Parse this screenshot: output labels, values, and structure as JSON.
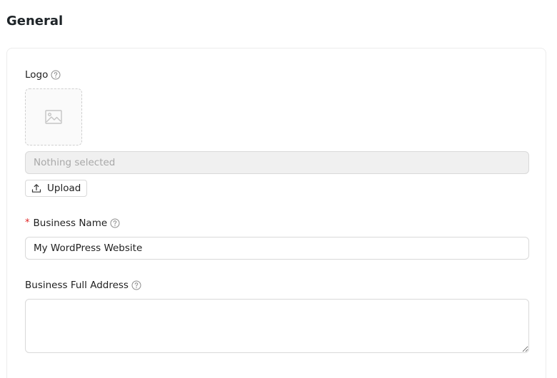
{
  "section": {
    "title": "General"
  },
  "logo": {
    "label": "Logo",
    "help_icon": "question-circle-icon",
    "placeholder_icon": "image-icon",
    "file_display": "Nothing selected",
    "upload_label": "Upload",
    "upload_icon": "upload-icon"
  },
  "business_name": {
    "required_mark": "*",
    "label": "Business Name",
    "help_icon": "question-circle-icon",
    "value": "My WordPress Website"
  },
  "business_address": {
    "label": "Business Full Address",
    "help_icon": "question-circle-icon",
    "value": ""
  },
  "colors": {
    "required": "#e02424",
    "border": "#d9d9d9",
    "disabled_bg": "#f0f0f0",
    "muted_text": "#a8a8a8"
  }
}
